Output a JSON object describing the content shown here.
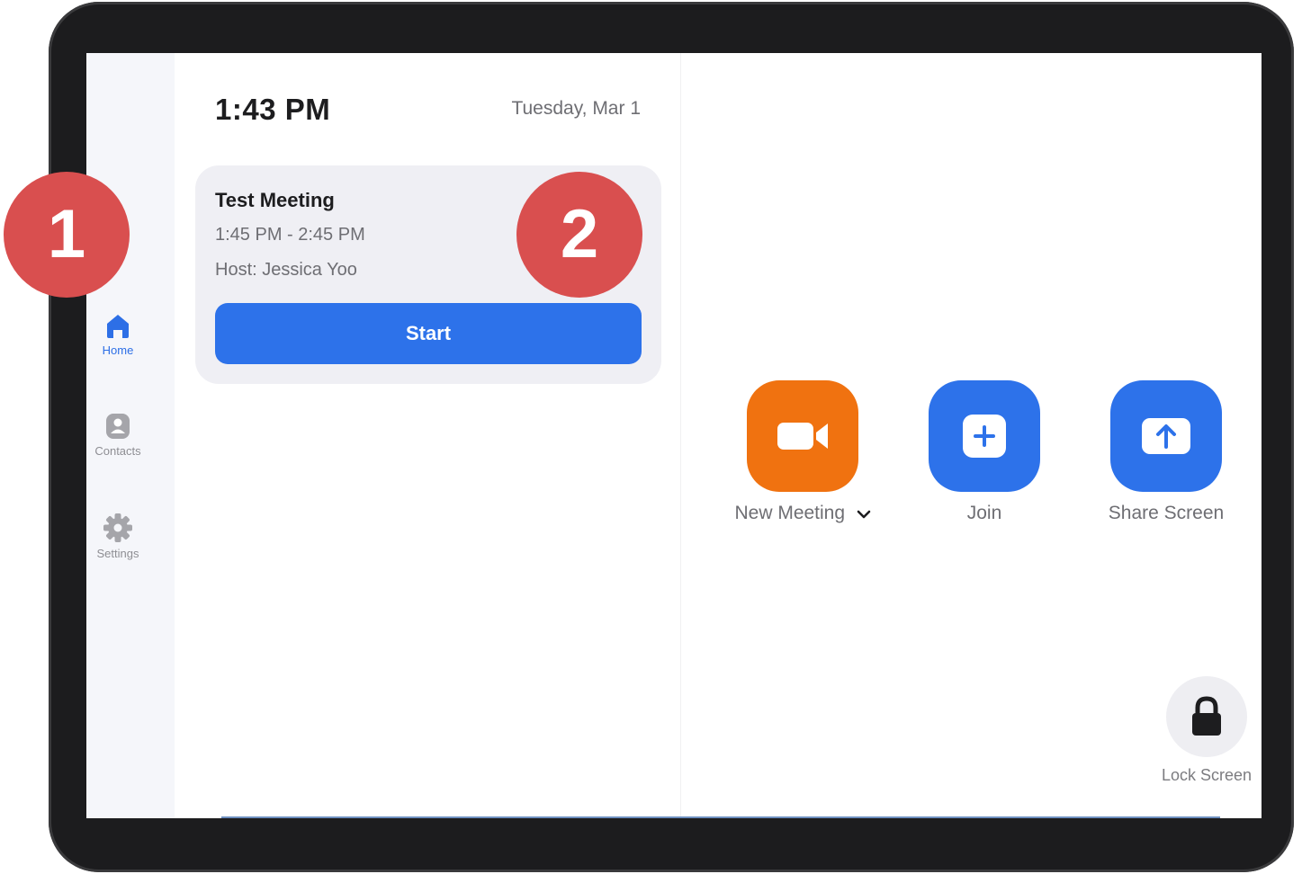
{
  "sidebar": {
    "items": [
      {
        "label": "Home",
        "icon": "home-icon",
        "active": true
      },
      {
        "label": "Contacts",
        "icon": "contact-card-icon",
        "active": false
      },
      {
        "label": "Settings",
        "icon": "gear-icon",
        "active": false
      }
    ]
  },
  "header": {
    "time": "1:43 PM",
    "date": "Tuesday, Mar 1"
  },
  "meeting": {
    "title": "Test Meeting",
    "time_range": "1:45 PM - 2:45 PM",
    "host": "Host: Jessica Yoo",
    "start_label": "Start"
  },
  "actions": [
    {
      "label": "New Meeting",
      "icon": "video-camera-icon",
      "color": "#f07210",
      "has_dropdown": true
    },
    {
      "label": "Join",
      "icon": "plus-icon",
      "color": "#2d72ea"
    },
    {
      "label": "Share Screen",
      "icon": "upload-arrow-icon",
      "color": "#2d72ea"
    }
  ],
  "lock": {
    "label": "Lock Screen",
    "icon": "lock-icon"
  },
  "callouts": [
    "1",
    "2"
  ],
  "colors": {
    "accent": "#2d72ea",
    "orange": "#f07210",
    "callout": "#d94f4f"
  }
}
